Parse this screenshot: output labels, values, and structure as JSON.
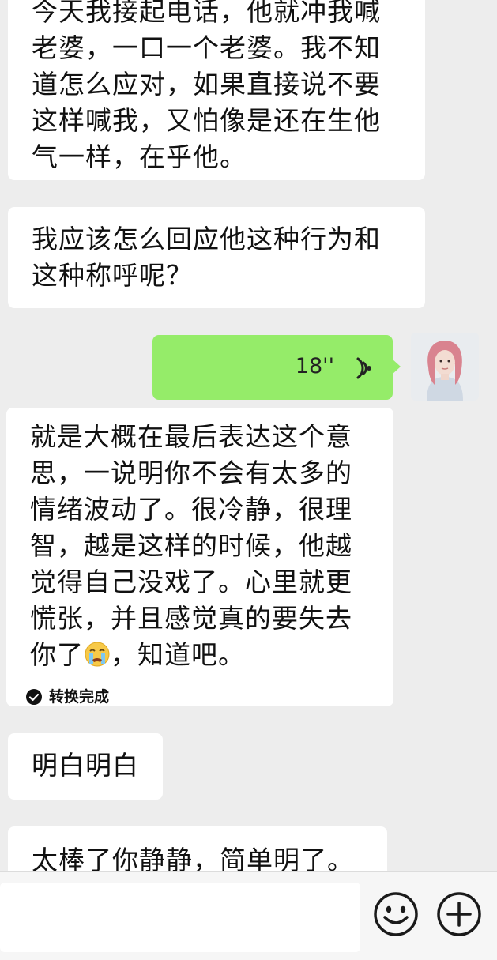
{
  "messages": [
    {
      "side": "left",
      "lines": [
        "今天我接起电话，他就冲我喊",
        "老婆，一口一个老婆。我不知",
        "道怎么应对，如果直接说不要",
        "这样喊我，又怕像是还在生他",
        "气一样，在乎他。"
      ]
    },
    {
      "side": "left",
      "lines": [
        "我应该怎么回应他这种行为和",
        "这种称呼呢？"
      ]
    },
    {
      "side": "right",
      "type": "voice",
      "duration": "18''",
      "icon": "voice-wave-icon"
    },
    {
      "side": "left",
      "type": "transcription",
      "lines": [
        "就是大概在最后表达这个意",
        "思，一说明你不会有太多的",
        "情绪波动了。很冷静，很理",
        "智，越是这样的时候，他越",
        "觉得自己没戏了。心里就更",
        "慌张，并且感觉真的要失去"
      ],
      "last_line_before_emoji": "你了",
      "emoji": "crying-emoji-icon",
      "last_line_after_emoji": "，知道吧。",
      "status": "转换完成"
    },
    {
      "side": "left",
      "lines": [
        "明白明白"
      ]
    },
    {
      "side": "left",
      "lines": [
        "太棒了你静静，简单明了。"
      ]
    }
  ],
  "input_bar": {
    "placeholder": "",
    "icons": [
      "emoji-icon",
      "plus-icon"
    ]
  },
  "colors": {
    "background": "#ededed",
    "sent_bubble": "#95ec69",
    "received_bubble": "#ffffff"
  }
}
